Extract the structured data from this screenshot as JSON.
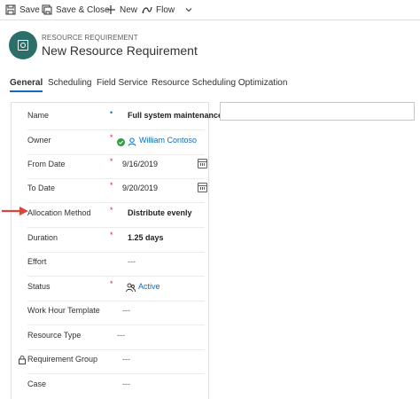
{
  "toolbar": {
    "save_label": "Save",
    "save_close_label": "Save & Close",
    "new_label": "New",
    "flow_label": "Flow"
  },
  "header": {
    "entity_type": "RESOURCE REQUIREMENT",
    "title": "New Resource Requirement"
  },
  "tabs": [
    {
      "label": "General",
      "active": true
    },
    {
      "label": "Scheduling"
    },
    {
      "label": "Field Service"
    },
    {
      "label": "Resource Scheduling Optimization"
    }
  ],
  "fields": {
    "name": {
      "label": "Name",
      "value": "Full system maintenance"
    },
    "owner": {
      "label": "Owner",
      "value": "William Contoso"
    },
    "from_date": {
      "label": "From Date",
      "value": "9/16/2019"
    },
    "to_date": {
      "label": "To Date",
      "value": "9/20/2019"
    },
    "allocation_method": {
      "label": "Allocation Method",
      "value": "Distribute evenly"
    },
    "duration": {
      "label": "Duration",
      "value": "1.25 days"
    },
    "effort": {
      "label": "Effort",
      "value": "---"
    },
    "status": {
      "label": "Status",
      "value": "Active"
    },
    "work_hour_template": {
      "label": "Work Hour Template",
      "value": "---"
    },
    "resource_type": {
      "label": "Resource Type",
      "value": "---"
    },
    "requirement_group": {
      "label": "Requirement Group",
      "value": "---"
    },
    "case": {
      "label": "Case",
      "value": "---"
    }
  },
  "colors": {
    "accent": "#0f6cbd",
    "required": "#c4314b",
    "avatar": "#2c6f6a",
    "annotation_arrow": "#d9463b",
    "owner_status": "#2e9b46"
  }
}
